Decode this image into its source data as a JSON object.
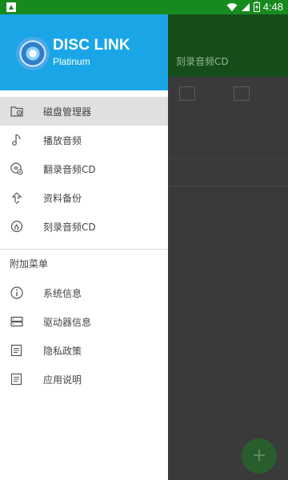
{
  "status_bar": {
    "time": "4:48"
  },
  "background": {
    "screen_title": "刻录音频CD"
  },
  "header": {
    "brand_title": "DISC LINK",
    "brand_subtitle": "Platinum"
  },
  "menu": [
    {
      "label": "磁盘管理器",
      "icon": "disk-manager-icon",
      "active": true
    },
    {
      "label": "播放音频",
      "icon": "music-note-icon",
      "active": false
    },
    {
      "label": "翻录音频CD",
      "icon": "disc-rip-icon",
      "active": false
    },
    {
      "label": "资料备份",
      "icon": "backup-upload-icon",
      "active": false
    },
    {
      "label": "刻录音频CD",
      "icon": "burn-icon",
      "active": false
    }
  ],
  "extra_section": {
    "title": "附加菜单",
    "items": [
      {
        "label": "系统信息",
        "icon": "info-icon"
      },
      {
        "label": "驱动器信息",
        "icon": "drive-icon"
      },
      {
        "label": "隐私政策",
        "icon": "document-icon"
      },
      {
        "label": "应用说明",
        "icon": "document-icon"
      }
    ]
  },
  "colors": {
    "header": "#1aa6e6",
    "status_bar": "#178a1f",
    "active_item": "#e0e0e0"
  }
}
